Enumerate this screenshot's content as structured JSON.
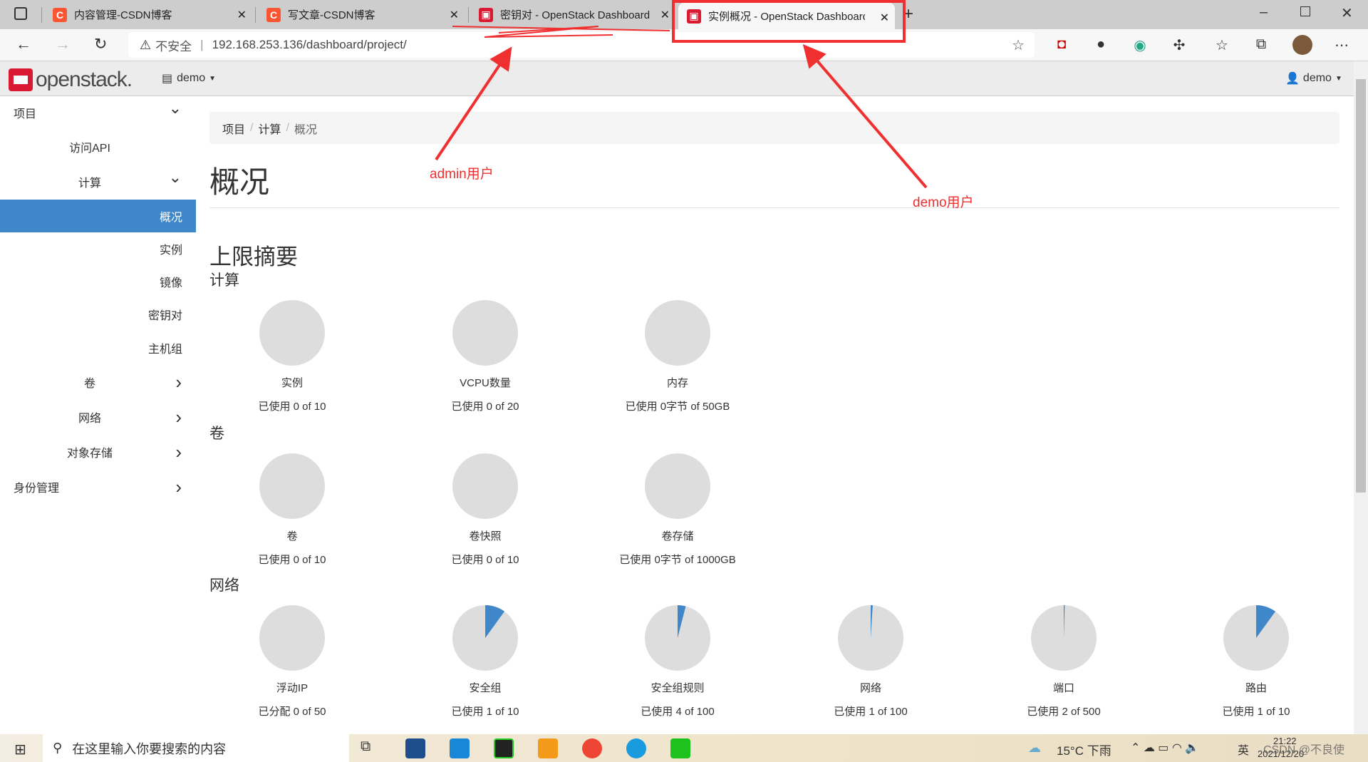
{
  "browser": {
    "tabs": [
      {
        "title": "内容管理-CSDN博客",
        "active": false
      },
      {
        "title": "写文章-CSDN博客",
        "active": false
      },
      {
        "title": "密钥对 - OpenStack Dashboard",
        "active": false
      },
      {
        "title": "实例概况 - OpenStack Dashboard",
        "active": true
      }
    ],
    "security_label": "不安全",
    "url": "192.168.253.136/dashboard/project/"
  },
  "header": {
    "logo": "openstack.",
    "project": "demo",
    "user": "demo"
  },
  "sidebar": {
    "items": [
      {
        "label": "项目",
        "level": 0,
        "chevron": "down"
      },
      {
        "label": "访问API",
        "level": 1
      },
      {
        "label": "计算",
        "level": 1,
        "chevron": "down"
      },
      {
        "label": "概况",
        "level": 2,
        "active": true
      },
      {
        "label": "实例",
        "level": 2
      },
      {
        "label": "镜像",
        "level": 2
      },
      {
        "label": "密钥对",
        "level": 2
      },
      {
        "label": "主机组",
        "level": 2
      },
      {
        "label": "卷",
        "level": 1,
        "chevron": "right"
      },
      {
        "label": "网络",
        "level": 1,
        "chevron": "right"
      },
      {
        "label": "对象存储",
        "level": 1,
        "chevron": "right"
      },
      {
        "label": "身份管理",
        "level": 0,
        "chevron": "right"
      }
    ]
  },
  "main": {
    "breadcrumb": [
      "项目",
      "计算",
      "概况"
    ],
    "title": "概况",
    "section_title": "上限摘要",
    "groups": [
      {
        "title": "计算",
        "items": [
          {
            "label": "实例",
            "usage": "已使用 0 of 10",
            "used": 0,
            "total": 10
          },
          {
            "label": "VCPU数量",
            "usage": "已使用 0 of 20",
            "used": 0,
            "total": 20
          },
          {
            "label": "内存",
            "usage": "已使用 0字节 of 50GB",
            "used": 0,
            "total": 50
          }
        ]
      },
      {
        "title": "卷",
        "items": [
          {
            "label": "卷",
            "usage": "已使用 0 of 10",
            "used": 0,
            "total": 10
          },
          {
            "label": "卷快照",
            "usage": "已使用 0 of 10",
            "used": 0,
            "total": 10
          },
          {
            "label": "卷存储",
            "usage": "已使用 0字节 of 1000GB",
            "used": 0,
            "total": 1000
          }
        ]
      },
      {
        "title": "网络",
        "items": [
          {
            "label": "浮动IP",
            "usage": "已分配 0 of 50",
            "used": 0,
            "total": 50
          },
          {
            "label": "安全组",
            "usage": "已使用 1 of 10",
            "used": 1,
            "total": 10
          },
          {
            "label": "安全组规则",
            "usage": "已使用 4 of 100",
            "used": 4,
            "total": 100
          },
          {
            "label": "网络",
            "usage": "已使用 1 of 100",
            "used": 1,
            "total": 100
          },
          {
            "label": "端口",
            "usage": "已使用 2 of 500",
            "used": 2,
            "total": 500
          },
          {
            "label": "路由",
            "usage": "已使用 1 of 10",
            "used": 1,
            "total": 10
          }
        ]
      }
    ]
  },
  "annotations": {
    "admin": "admin用户",
    "demo": "demo用户"
  },
  "taskbar": {
    "search_placeholder": "在这里输入你要搜索的内容",
    "weather": "15°C 下雨",
    "ime": "英",
    "time": "21:22",
    "date": "2021/12/20",
    "watermark": "CSDN @不良使"
  },
  "colors": {
    "accent": "#3f87c8",
    "pie_bg": "#dddddd",
    "annotation": "#f03030",
    "csdn": "#fc5531",
    "openstack": "#da1a32"
  }
}
